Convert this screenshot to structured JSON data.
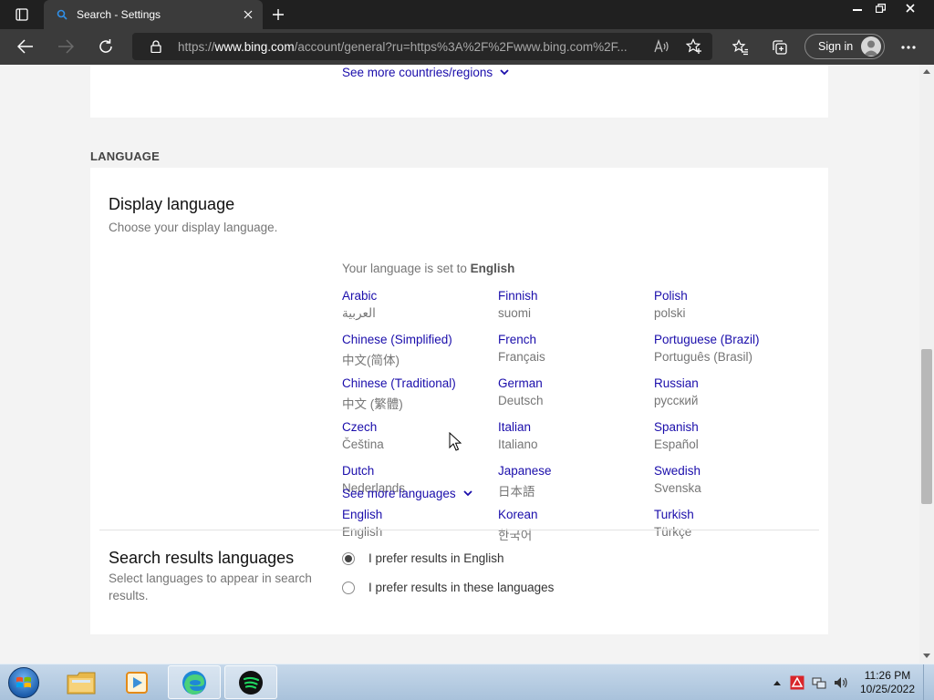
{
  "browser": {
    "tab_title": "Search - Settings",
    "url_prefix": "https://",
    "url_host": "www.bing.com",
    "url_rest": "/account/general?ru=https%3A%2F%2Fwww.bing.com%2F...",
    "signin_label": "Sign in"
  },
  "region": {
    "see_more_label": "See more countries/regions"
  },
  "language_section": {
    "heading": "LANGUAGE",
    "display_title": "Display language",
    "display_desc": "Choose your display language.",
    "status_prefix": "Your language is set to ",
    "status_value": "English",
    "languages": [
      {
        "name": "Arabic",
        "native": "العربية"
      },
      {
        "name": "Chinese (Simplified)",
        "native": "中文(简体)"
      },
      {
        "name": "Chinese (Traditional)",
        "native": "中文 (繁體)"
      },
      {
        "name": "Czech",
        "native": "Čeština"
      },
      {
        "name": "Dutch",
        "native": "Nederlands"
      },
      {
        "name": "English",
        "native": "English"
      },
      {
        "name": "Finnish",
        "native": "suomi"
      },
      {
        "name": "French",
        "native": "Français"
      },
      {
        "name": "German",
        "native": "Deutsch"
      },
      {
        "name": "Italian",
        "native": "Italiano"
      },
      {
        "name": "Japanese",
        "native": "日本語"
      },
      {
        "name": "Korean",
        "native": "한국어"
      },
      {
        "name": "Polish",
        "native": "polski"
      },
      {
        "name": "Portuguese (Brazil)",
        "native": "Português (Brasil)"
      },
      {
        "name": "Russian",
        "native": "русский"
      },
      {
        "name": "Spanish",
        "native": "Español"
      },
      {
        "name": "Swedish",
        "native": "Svenska"
      },
      {
        "name": "Turkish",
        "native": "Türkçe"
      }
    ],
    "see_more_label": "See more languages",
    "results_title": "Search results languages",
    "results_desc": "Select languages to appear in search results.",
    "results_options": [
      {
        "label": "I prefer results in English",
        "selected": true
      },
      {
        "label": "I prefer results in these languages",
        "selected": false
      }
    ]
  },
  "taskbar": {
    "time": "11:26 PM",
    "date": "10/25/2022",
    "apps": [
      "file-explorer-icon",
      "media-player-icon",
      "edge-icon",
      "spotify-icon"
    ]
  },
  "colors": {
    "link": "#1a0dab",
    "muted": "#767676",
    "chrome_dark": "#202020",
    "toolbar": "#3b3b3b"
  }
}
